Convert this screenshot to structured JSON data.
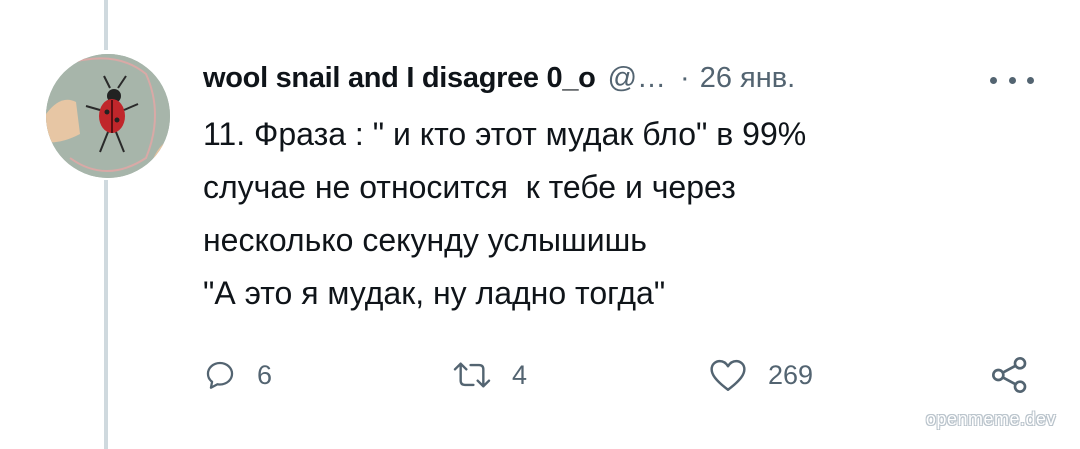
{
  "tweet": {
    "author_name": "wool snail and I disagree 0_o",
    "handle": "@…",
    "separator": "·",
    "date": "26 янв.",
    "text_lines": [
      "11. Фраза : \" и кто этот мудак бло\" в 99%",
      "случае не относится  к тебе и через",
      "несколько секунду услышишь",
      "\"А это я мудак, ну ладно тогда\""
    ]
  },
  "actions": {
    "replies": "6",
    "retweets": "4",
    "likes": "269"
  },
  "icons": {
    "reply": "speech-bubble-icon",
    "retweet": "retweet-arrows-icon",
    "like": "heart-icon",
    "share": "share-nodes-icon",
    "more": "more-dots-icon"
  },
  "watermark": "openmeme.dev",
  "colors": {
    "text": "#0f1419",
    "secondary": "#536471",
    "thread_line": "#cfd9de"
  }
}
